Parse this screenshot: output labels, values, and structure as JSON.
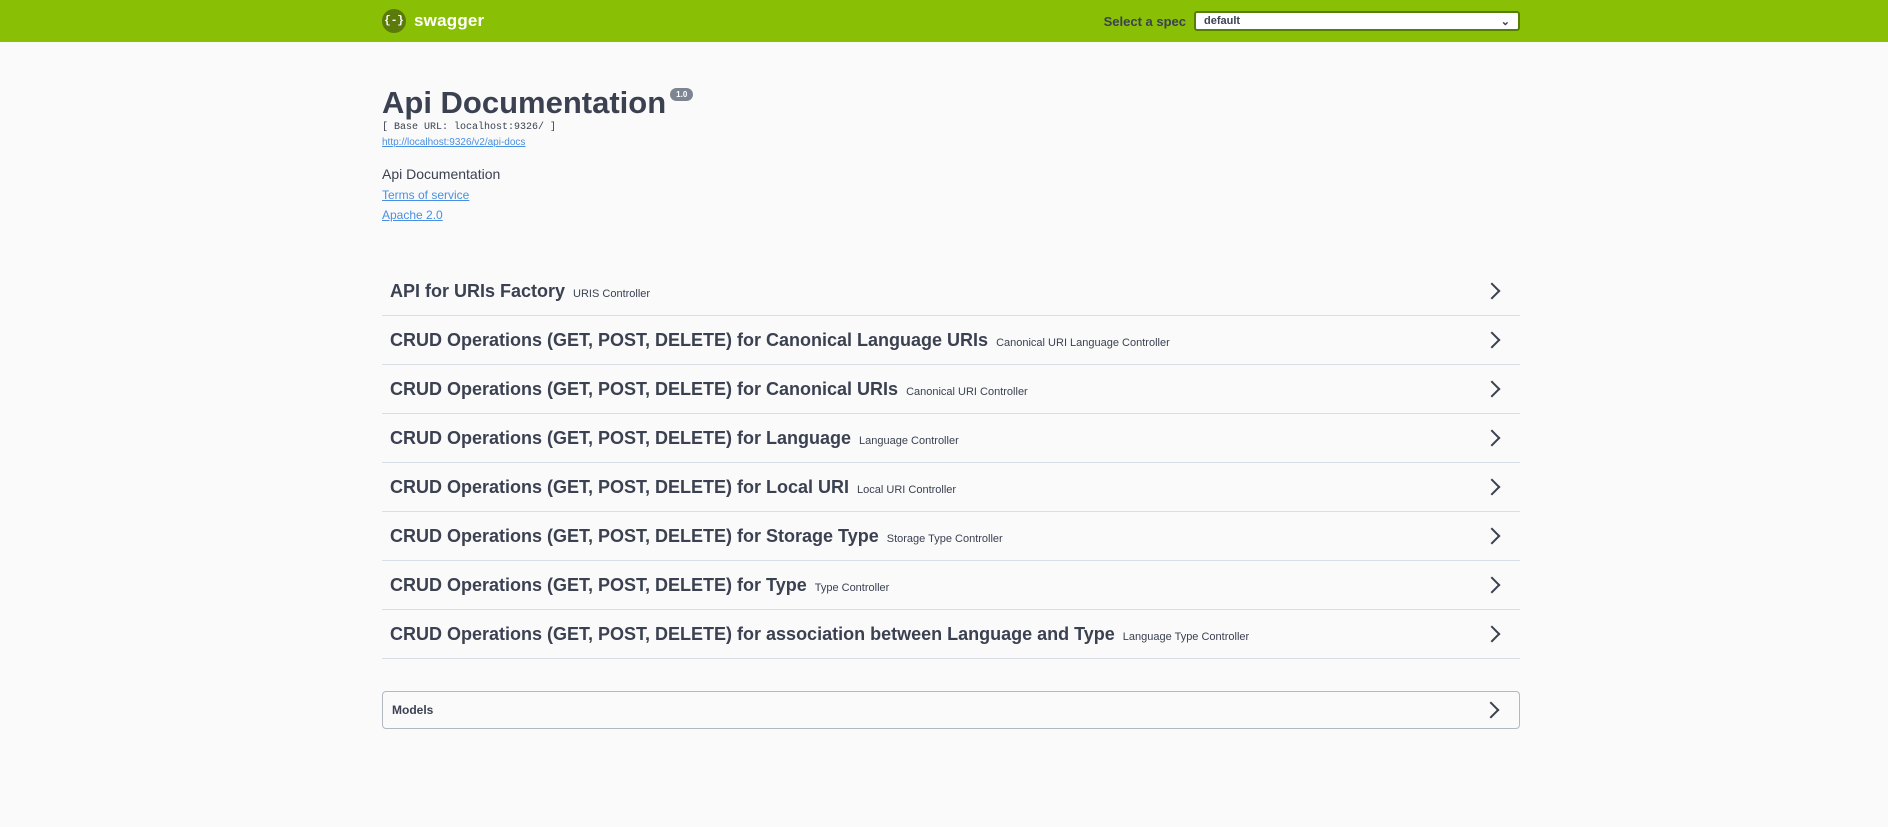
{
  "topbar": {
    "logo_glyph": "{-}",
    "logo_text": "swagger",
    "spec_label": "Select a spec",
    "spec_value": "default"
  },
  "info": {
    "title": "Api Documentation",
    "version": "1.0",
    "base_url": "[ Base URL: localhost:9326/ ]",
    "api_docs_link": "http://localhost:9326/v2/api-docs",
    "description": "Api Documentation",
    "terms": "Terms of service",
    "license": "Apache 2.0"
  },
  "tags": [
    {
      "name": "API for URIs Factory",
      "desc": "URIS Controller"
    },
    {
      "name": "CRUD Operations (GET, POST, DELETE) for Canonical Language URIs",
      "desc": "Canonical URI Language Controller"
    },
    {
      "name": "CRUD Operations (GET, POST, DELETE) for Canonical URIs",
      "desc": "Canonical URI Controller"
    },
    {
      "name": "CRUD Operations (GET, POST, DELETE) for Language",
      "desc": "Language Controller"
    },
    {
      "name": "CRUD Operations (GET, POST, DELETE) for Local URI",
      "desc": "Local URI Controller"
    },
    {
      "name": "CRUD Operations (GET, POST, DELETE) for Storage Type",
      "desc": "Storage Type Controller"
    },
    {
      "name": "CRUD Operations (GET, POST, DELETE) for Type",
      "desc": "Type Controller"
    },
    {
      "name": "CRUD Operations (GET, POST, DELETE) for association between Language and Type",
      "desc": "Language Type Controller"
    }
  ],
  "models": {
    "label": "Models"
  },
  "colors": {
    "topbar": "#89bf04",
    "link": "#4990e2",
    "text": "#3b4151"
  }
}
